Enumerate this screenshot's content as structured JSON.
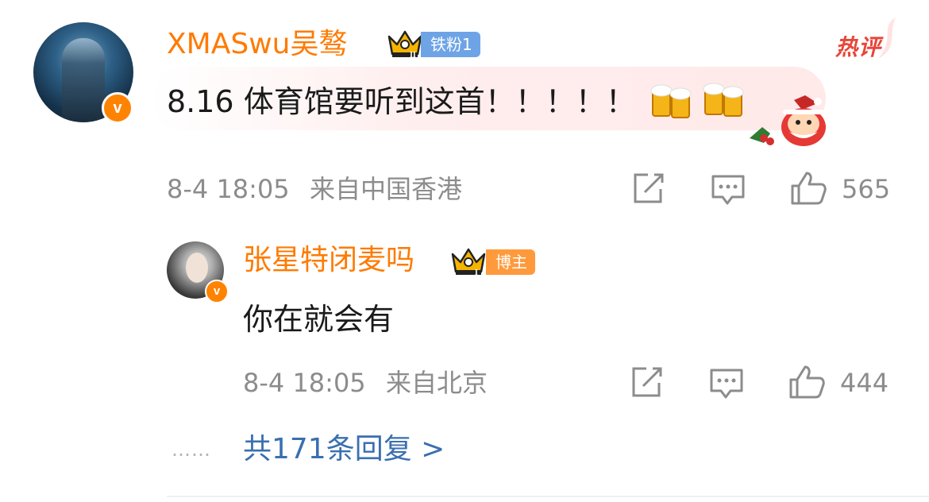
{
  "comment": {
    "username": "XMASwu吴骜",
    "fan_badge": "铁粉1",
    "hot_label": "热评",
    "text": "8.16 体育馆要听到这首！！！！！",
    "time": "8-4 18:05",
    "location": "来自中国香港",
    "like_count": "565",
    "verified_mark": "v"
  },
  "reply": {
    "username": "张星特闭麦吗",
    "badge": "博主",
    "text": "你在就会有",
    "time": "8-4 18:05",
    "location": "来自北京",
    "like_count": "444",
    "verified_mark": "v"
  },
  "more_replies": {
    "label": "共171条回复 >",
    "dots": "……"
  },
  "icons": {
    "share": "share-icon",
    "comment": "comment-icon",
    "like": "thumbs-up-icon",
    "crown": "crown-icon",
    "beer": "beer-emoji",
    "santa": "santa-sticker"
  },
  "colors": {
    "username": "#ff7a00",
    "hot": "#e8463a",
    "link": "#3a6fb0",
    "meta": "#8c8c8c",
    "fan_badge": "#6ea4e6",
    "blogger_badge": "#ff9a3c"
  }
}
